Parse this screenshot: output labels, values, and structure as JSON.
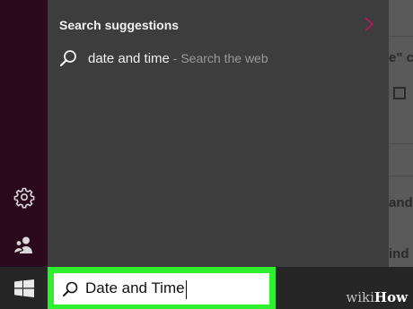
{
  "search_panel": {
    "section_header": "Search suggestions",
    "suggestion": {
      "query": "date and time",
      "hint": " - Search the web",
      "icon": "search-icon"
    }
  },
  "background_window": {
    "text_1": "e\" c",
    "text_2": "and",
    "text_3": "ind"
  },
  "taskbar": {
    "search_value": "Date and Time"
  },
  "watermark": {
    "prefix": "wiki",
    "suffix": "How"
  },
  "colors": {
    "rail": "#2c0a1e",
    "panel": "#3d3d3d",
    "highlight": "#2ff02f",
    "chevron": "#b5195b"
  }
}
